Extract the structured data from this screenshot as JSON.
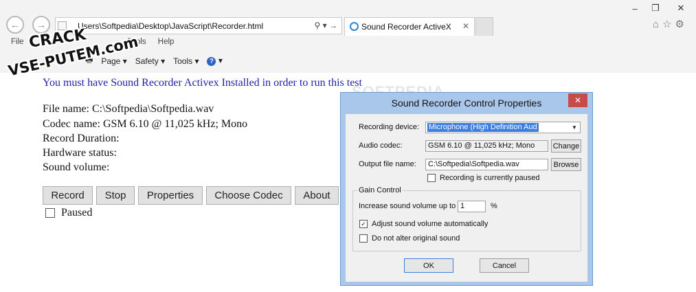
{
  "browser": {
    "address": "Users\\Softpedia\\Desktop\\JavaScript\\Recorder.html",
    "address_actions": "⚲ ▾ →",
    "tab_title": "Sound Recorder ActiveX",
    "tab_close": "✕",
    "menu": [
      "File",
      "Tools",
      "Help"
    ],
    "commands": [
      "Page ▾",
      "Safety ▾",
      "Tools ▾"
    ],
    "window_controls": {
      "minimize": "–",
      "restore": "❐",
      "close": "✕"
    }
  },
  "watermark": {
    "line1": "CRACK",
    "line2": "VSE-PUTEM.com"
  },
  "page": {
    "headline": "You must have Sound Recorder Activex Installed in order to run this test",
    "file_name": "File name:  C:\\Softpedia\\Softpedia.wav",
    "codec_name": "Codec name:  GSM 6.10 @ 11,025 kHz; Mono",
    "record_duration": "Record Duration:",
    "hardware_status": "Hardware status:",
    "sound_volume": "Sound volume:",
    "buttons": {
      "record": "Record",
      "stop": "Stop",
      "properties": "Properties",
      "choose_codec": "Choose Codec",
      "about": "About"
    },
    "paused_label": "Paused"
  },
  "dialog": {
    "title": "Sound Recorder Control Properties",
    "close": "✕",
    "recording_device_label": "Recording device:",
    "recording_device_value": "Microphone (High Definition Aud",
    "audio_codec_label": "Audio codec:",
    "audio_codec_value": "GSM 6.10 @ 11,025 kHz; Mono",
    "change_button": "Change",
    "output_file_label": "Output file name:",
    "output_file_value": "C:\\Softpedia\\Softpedia.wav",
    "browse_button": "Browse",
    "paused_checkbox": "Recording is currently paused",
    "gain_group": "Gain Control",
    "increase_label": "Increase sound volume up to",
    "increase_value": "1",
    "percent": "%",
    "adjust_auto": "Adjust sound volume automatically",
    "adjust_auto_checked": true,
    "no_alter": "Do not alter original sound",
    "ok": "OK",
    "cancel": "Cancel"
  },
  "softpedia_mark": "SOFTPEDIA",
  "colors": {
    "headline": "#1f1fa8",
    "dialog_frame": "#a9c7ea",
    "close_red": "#c74b48",
    "selection": "#3c7de0"
  }
}
